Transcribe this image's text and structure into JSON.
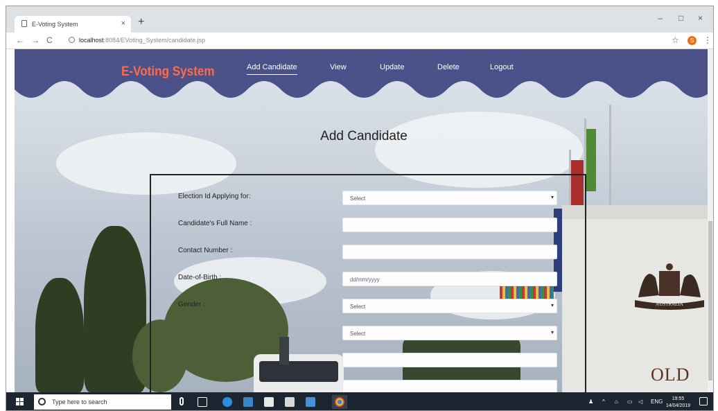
{
  "browser": {
    "tab_title": "E-Voting System",
    "tab_close": "×",
    "new_tab": "+",
    "back": "←",
    "forward": "→",
    "reload": "C",
    "url_host": "localhost",
    "url_path": ":8084/EVoting_System/candidate.jsp",
    "star": "☆",
    "profile_initial": "S",
    "menu": "⋮",
    "minimize": "–",
    "maximize": "□",
    "close": "×"
  },
  "header": {
    "brand": "E-Voting System",
    "brand_color": "#ff6a47",
    "bar_color": "#4b5189",
    "nav": [
      "Add Candidate",
      "View",
      "Update",
      "Delete",
      "Logout"
    ],
    "active_nav": "Add Candidate"
  },
  "page": {
    "title": "Add Candidate"
  },
  "form": {
    "labels": [
      "Election Id Applying for:",
      "Candidate's Full Name :",
      "Contact Number :",
      "Date-of-Birth :",
      "Gender :"
    ],
    "election_select": "Select",
    "full_name_value": "",
    "contact_value": "",
    "dob_placeholder": "dd/mm/yyyy",
    "gender_select": "Select",
    "extra_select": "Select",
    "extra_field_1": "",
    "extra_field_2": ""
  },
  "background": {
    "building_text": "OLD",
    "crest_text": "AUSTRALIA"
  },
  "taskbar": {
    "search_placeholder": "Type here to search",
    "language": "ENG",
    "time": "19:55",
    "date": "14/04/2019"
  }
}
